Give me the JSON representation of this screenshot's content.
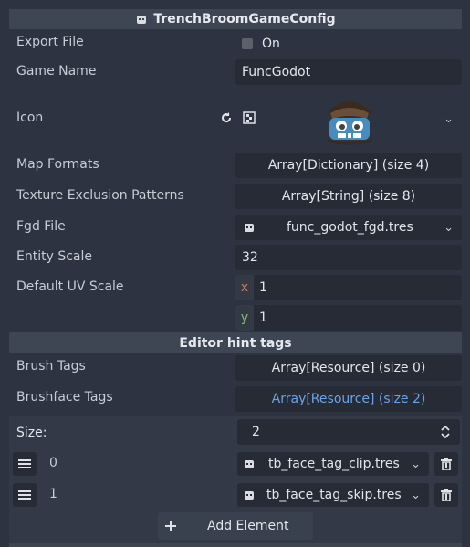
{
  "header": {
    "title": "TrenchBroomGameConfig"
  },
  "props": {
    "export_file": {
      "label": "Export File",
      "value": "On"
    },
    "game_name": {
      "label": "Game Name",
      "value": "FuncGodot"
    },
    "icon": {
      "label": "Icon"
    },
    "map_formats": {
      "label": "Map Formats",
      "value": "Array[Dictionary] (size 4)"
    },
    "texture_exclusion": {
      "label": "Texture Exclusion Patterns",
      "value": "Array[String] (size 8)"
    },
    "fgd_file": {
      "label": "Fgd File",
      "value": "func_godot_fgd.tres"
    },
    "entity_scale": {
      "label": "Entity Scale",
      "value": "32"
    },
    "default_uv_scale": {
      "label": "Default UV Scale",
      "x_label": "x",
      "x_value": "1",
      "y_label": "y",
      "y_value": "1"
    }
  },
  "hint_section": {
    "title": "Editor hint tags"
  },
  "brush_tags": {
    "label": "Brush Tags",
    "value": "Array[Resource] (size 0)"
  },
  "brushface_tags": {
    "label": "Brushface Tags",
    "value": "Array[Resource] (size 2)"
  },
  "array_editor": {
    "size_label": "Size:",
    "size_value": "2",
    "items": [
      {
        "index": "0",
        "value": "tb_face_tag_clip.tres"
      },
      {
        "index": "1",
        "value": "tb_face_tag_skip.tres"
      }
    ],
    "add_label": "Add Element"
  },
  "colors": {
    "link": "#6aa3e8",
    "axis_x": "#cc7a66",
    "axis_y": "#7fb67a"
  },
  "icons": [
    "resource-icon",
    "revert-icon",
    "checker-icon",
    "godot-logo",
    "chevron-down-icon",
    "drag-handle-icon",
    "trash-icon",
    "plus-icon",
    "spinner-icon"
  ]
}
